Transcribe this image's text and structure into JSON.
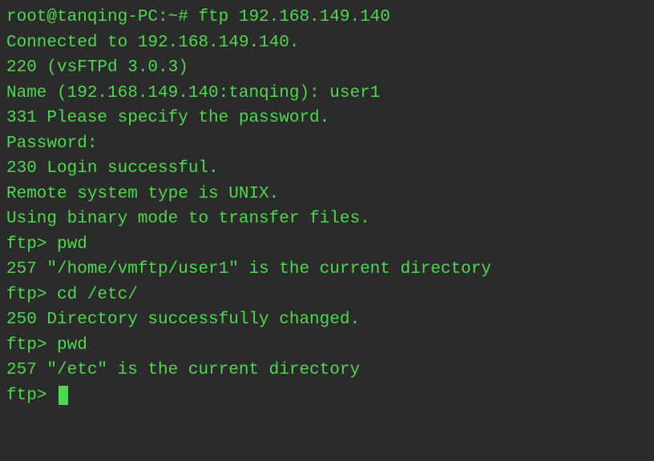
{
  "lines": [
    "root@tanqing-PC:~# ftp 192.168.149.140",
    "Connected to 192.168.149.140.",
    "220 (vsFTPd 3.0.3)",
    "Name (192.168.149.140:tanqing): user1",
    "331 Please specify the password.",
    "Password:",
    "230 Login successful.",
    "Remote system type is UNIX.",
    "Using binary mode to transfer files.",
    "ftp> pwd",
    "257 \"/home/vmftp/user1\" is the current directory",
    "ftp> cd /etc/",
    "250 Directory successfully changed.",
    "ftp> pwd",
    "257 \"/etc\" is the current directory",
    "ftp> "
  ]
}
